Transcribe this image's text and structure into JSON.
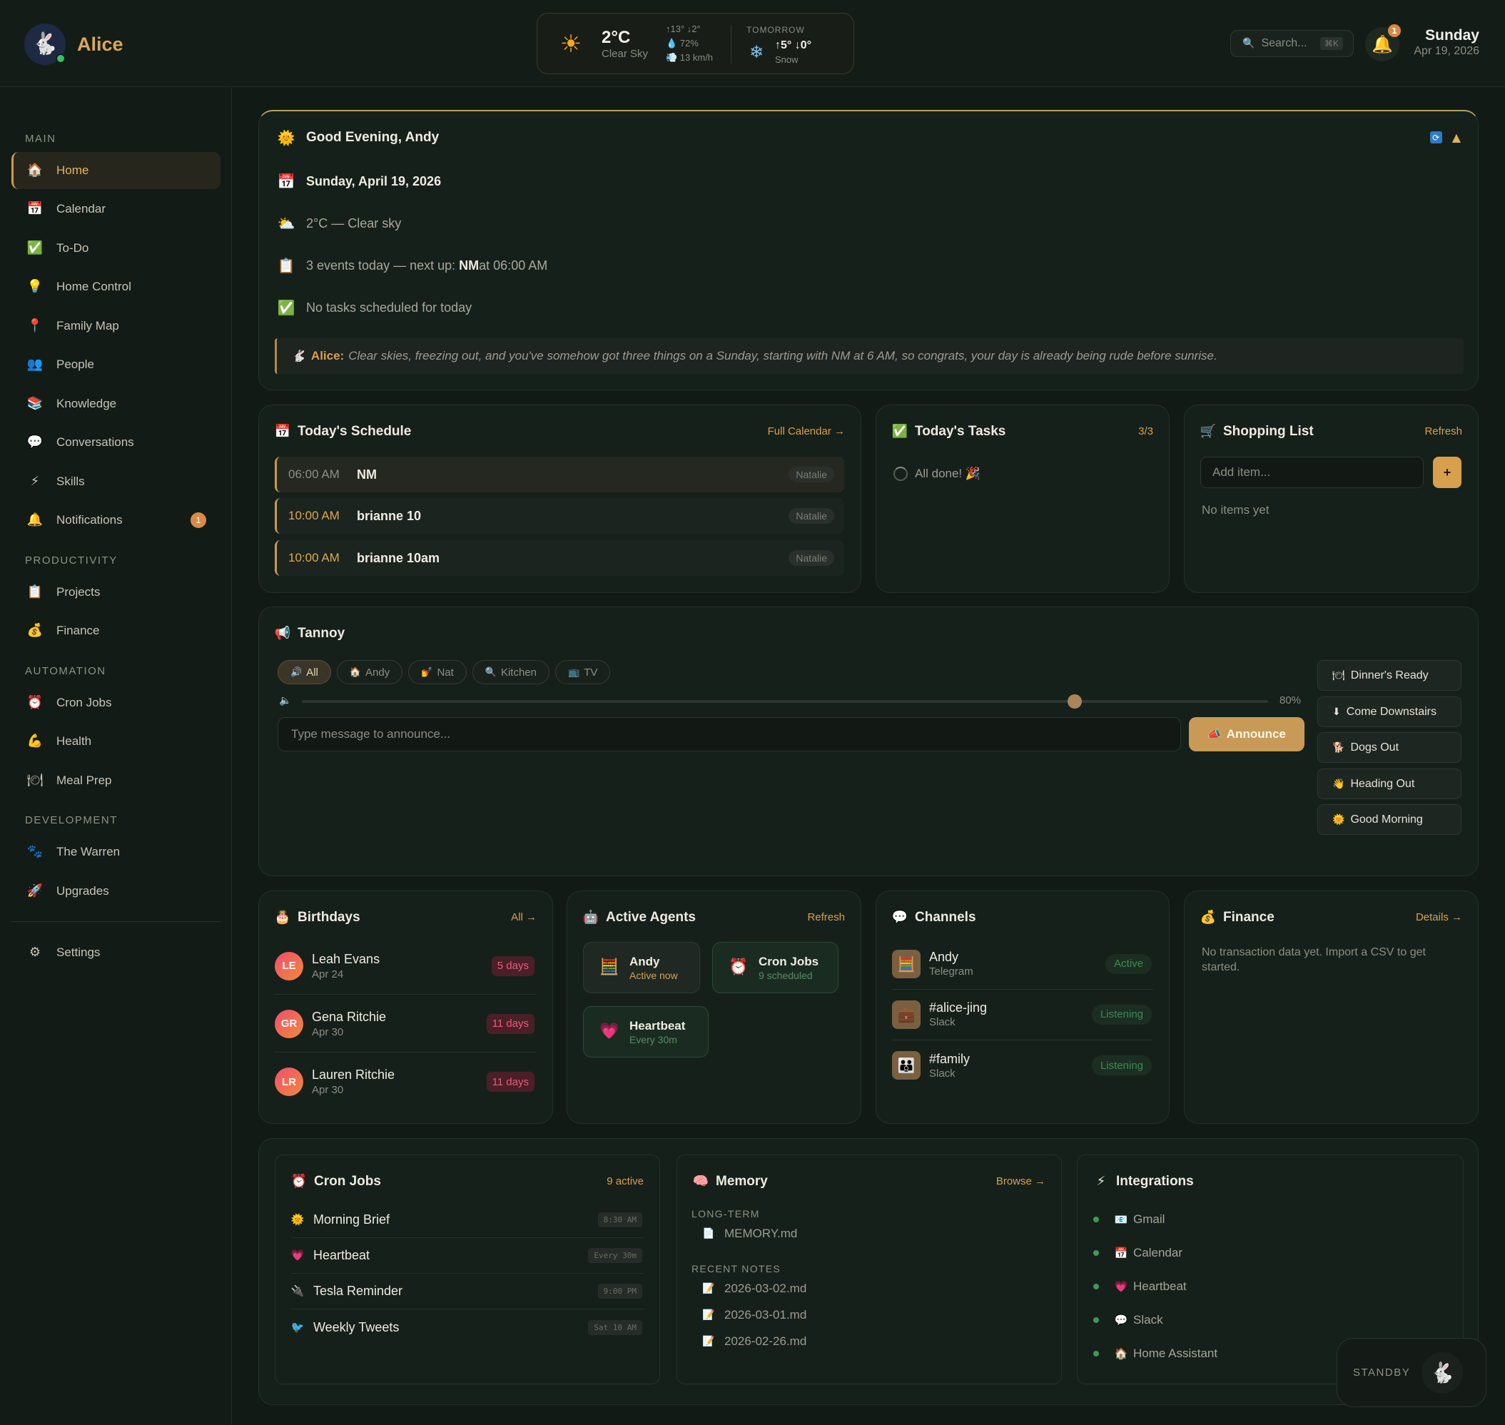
{
  "app": {
    "name": "Alice",
    "avatar_icon": "rabbit-icon"
  },
  "weather": {
    "temp": "2°C",
    "condition": "Clear Sky",
    "hilo": "↑13° ↓2°",
    "humidity": "💧 72%",
    "wind": "💨 13 km/h",
    "tomorrow_label": "TOMORROW",
    "tomorrow_hilo": "↑5° ↓0°",
    "tomorrow_condition": "Snow"
  },
  "search": {
    "placeholder": "Search...",
    "shortcut": "⌘K"
  },
  "notifications": {
    "count": "1"
  },
  "today": {
    "day": "Sunday",
    "date": "Apr 19, 2026"
  },
  "sidebar": {
    "sections": {
      "main": "MAIN",
      "productivity": "PRODUCTIVITY",
      "automation": "AUTOMATION",
      "development": "DEVELOPMENT"
    },
    "items": [
      {
        "label": "Home",
        "icon": "🏠"
      },
      {
        "label": "Calendar",
        "icon": "📅"
      },
      {
        "label": "To-Do",
        "icon": "✅"
      },
      {
        "label": "Home Control",
        "icon": "💡"
      },
      {
        "label": "Family Map",
        "icon": "📍"
      },
      {
        "label": "People",
        "icon": "👥"
      },
      {
        "label": "Knowledge",
        "icon": "📚"
      },
      {
        "label": "Conversations",
        "icon": "💬"
      },
      {
        "label": "Skills",
        "icon": "⚡"
      },
      {
        "label": "Notifications",
        "icon": "🔔",
        "badge": "1"
      },
      {
        "label": "Projects",
        "icon": "📋"
      },
      {
        "label": "Finance",
        "icon": "💰"
      },
      {
        "label": "Cron Jobs",
        "icon": "⏰"
      },
      {
        "label": "Health",
        "icon": "💪"
      },
      {
        "label": "Meal Prep",
        "icon": "🍽"
      },
      {
        "label": "The Warren",
        "icon": "🐾"
      },
      {
        "label": "Upgrades",
        "icon": "🚀"
      },
      {
        "label": "Settings",
        "icon": "⚙"
      }
    ]
  },
  "greeting": {
    "headline": "Good Evening, Andy",
    "date": "Sunday, April 19, 2026",
    "weather": "2°C — Clear sky",
    "events_prefix": "3 events today — next up: ",
    "events_next": "NM",
    "events_suffix": " at 06:00 AM",
    "tasks": "No tasks scheduled for today",
    "alice_label": "Alice:",
    "alice_message": "Clear skies, freezing out, and you've somehow got three things on a Sunday, starting with NM at 6 AM, so congrats, your day is already being rude before sunrise."
  },
  "schedule": {
    "title": "Today's Schedule",
    "link": "Full Calendar →",
    "events": [
      {
        "time": "06:00 AM",
        "title": "NM",
        "who": "Natalie"
      },
      {
        "time": "10:00 AM",
        "title": "brianne 10",
        "who": "Natalie"
      },
      {
        "time": "10:00 AM",
        "title": "brianne 10am",
        "who": "Natalie"
      }
    ]
  },
  "tasks": {
    "title": "Today's Tasks",
    "count": "3/3",
    "empty": "All done! 🎉"
  },
  "shopping": {
    "title": "Shopping List",
    "link": "Refresh",
    "placeholder": "Add item...",
    "add_label": "+",
    "empty": "No items yet"
  },
  "tannoy": {
    "title": "Tannoy",
    "targets": [
      {
        "label": "All",
        "icon": "🔊"
      },
      {
        "label": "Andy",
        "icon": "🏠"
      },
      {
        "label": "Nat",
        "icon": "💅"
      },
      {
        "label": "Kitchen",
        "icon": "🔍"
      },
      {
        "label": "TV",
        "icon": "📺"
      }
    ],
    "volume": 80,
    "volume_label": "80%",
    "placeholder": "Type message to announce...",
    "announce_label": "Announce",
    "presets": [
      {
        "label": "Dinner's Ready",
        "icon": "🍽"
      },
      {
        "label": "Come Downstairs",
        "icon": "⬇"
      },
      {
        "label": "Dogs Out",
        "icon": "🐕"
      },
      {
        "label": "Heading Out",
        "icon": "👋"
      },
      {
        "label": "Good Morning",
        "icon": "🌞"
      }
    ]
  },
  "birthdays": {
    "title": "Birthdays",
    "link": "All →",
    "people": [
      {
        "initials": "LE",
        "name": "Leah Evans",
        "date": "Apr 24",
        "days": "5 days"
      },
      {
        "initials": "GR",
        "name": "Gena Ritchie",
        "date": "Apr 30",
        "days": "11 days"
      },
      {
        "initials": "LR",
        "name": "Lauren Ritchie",
        "date": "Apr 30",
        "days": "11 days"
      }
    ]
  },
  "agents": {
    "title": "Active Agents",
    "link": "Refresh",
    "list": [
      {
        "name": "Andy",
        "status": "Active now",
        "icon": "🧮"
      },
      {
        "name": "Cron Jobs",
        "status": "9 scheduled",
        "icon": "⏰"
      },
      {
        "name": "Heartbeat",
        "status": "Every 30m",
        "icon": "💗"
      }
    ]
  },
  "channels": {
    "title": "Channels",
    "list": [
      {
        "name": "Andy",
        "platform": "Telegram",
        "status": "Active",
        "icon": "🧮"
      },
      {
        "name": "#alice-jing",
        "platform": "Slack",
        "status": "Listening",
        "icon": "💼"
      },
      {
        "name": "#family",
        "platform": "Slack",
        "status": "Listening",
        "icon": "👪"
      }
    ]
  },
  "finance": {
    "title": "Finance",
    "link": "Details →",
    "empty": "No transaction data yet. Import a CSV to get started."
  },
  "cron": {
    "title": "Cron Jobs",
    "count": "9 active",
    "jobs": [
      {
        "name": "Morning Brief",
        "time": "8:30 AM",
        "icon": "🌞"
      },
      {
        "name": "Heartbeat",
        "time": "Every 30m",
        "icon": "💗"
      },
      {
        "name": "Tesla Reminder",
        "time": "9:00 PM",
        "icon": "🔌"
      },
      {
        "name": "Weekly Tweets",
        "time": "Sat 10 AM",
        "icon": "🐦"
      }
    ]
  },
  "memory": {
    "title": "Memory",
    "link": "Browse →",
    "long_term_label": "LONG-TERM",
    "long_term": [
      "MEMORY.md"
    ],
    "recent_label": "RECENT NOTES",
    "recent": [
      "2026-03-02.md",
      "2026-03-01.md",
      "2026-02-26.md"
    ]
  },
  "integrations": {
    "title": "Integrations",
    "list": [
      {
        "name": "Gmail",
        "icon": "📧"
      },
      {
        "name": "Calendar",
        "icon": "📅"
      },
      {
        "name": "Heartbeat",
        "icon": "💗"
      },
      {
        "name": "Slack",
        "icon": "💬"
      },
      {
        "name": "Home Assistant",
        "icon": "🏠"
      }
    ]
  },
  "standby": {
    "label": "STANDBY"
  }
}
